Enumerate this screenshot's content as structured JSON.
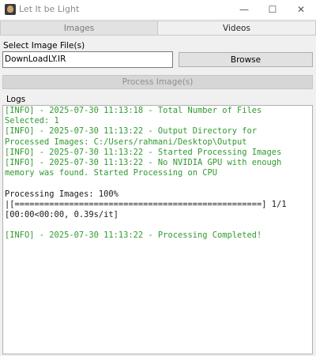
{
  "window": {
    "title": "Let It be Light",
    "minimize_glyph": "—",
    "maximize_glyph": "☐",
    "close_glyph": "✕"
  },
  "tabs": [
    {
      "label": "Images",
      "active": false
    },
    {
      "label": "Videos",
      "active": true
    }
  ],
  "select_image": {
    "label": "Select Image File(s)",
    "value": "DownLoadLY.IR",
    "browse_label": "Browse"
  },
  "process_button_label": "Process Image(s)",
  "logs": {
    "label": "Logs",
    "lines": [
      {
        "text": "[INFO] - 2025-07-30 11:13:18 - Total Number of Files",
        "type": "info"
      },
      {
        "text": "Selected: 1",
        "type": "info"
      },
      {
        "text": "[INFO] - 2025-07-30 11:13:22 - Output Directory for",
        "type": "info"
      },
      {
        "text": "Processed Images: C:/Users/rahmani/Desktop\\Output",
        "type": "info"
      },
      {
        "text": "[INFO] - 2025-07-30 11:13:22 - Started Processing Images",
        "type": "info"
      },
      {
        "text": "[INFO] - 2025-07-30 11:13:22 - No NVIDIA GPU with enough",
        "type": "info"
      },
      {
        "text": "memory was found. Started Processing on CPU",
        "type": "info"
      },
      {
        "text": "",
        "type": "plain"
      },
      {
        "text": "Processing Images: 100%",
        "type": "plain"
      },
      {
        "text": "|[==================================================] 1/1",
        "type": "plain"
      },
      {
        "text": "[00:00<00:00, 0.39s/it]",
        "type": "plain"
      },
      {
        "text": "",
        "type": "plain"
      },
      {
        "text": "[INFO] - 2025-07-30 11:13:22 - Processing Completed!",
        "type": "info"
      }
    ]
  },
  "colors": {
    "info_text": "#2e9b2e",
    "plain_text": "#1a1a1a"
  }
}
